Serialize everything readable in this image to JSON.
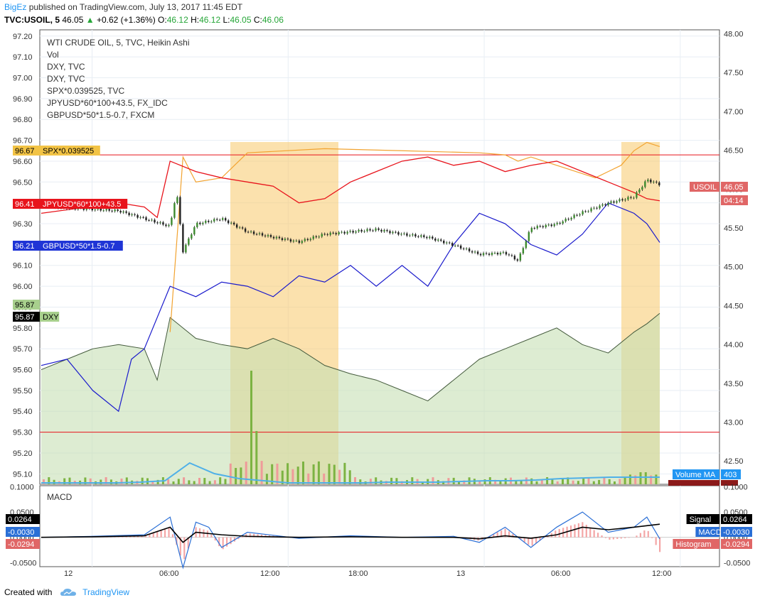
{
  "header": {
    "author": "BigEz",
    "published_text": "published on TradingView.com, July 13, 2017 11:45 EDT",
    "symbol": "TVC:USOIL, 5",
    "last": "46.05",
    "change": "+0.62 (+1.36%)",
    "o_label": "O:",
    "o": "46.12",
    "h_label": "H:",
    "h": "46.12",
    "l_label": "L:",
    "l": "46.05",
    "c_label": "C:",
    "c": "46.06"
  },
  "legend": [
    "WTI CRUDE OIL, 5, TVC, Heikin Ashi",
    "Vol",
    "DXY, TVC",
    "DXY, TVC",
    "SPX*0.039525, TVC",
    "JPYUSD*60*100+43.5, FX_IDC",
    "GBPUSD*50*1.5-0.7, FXCM"
  ],
  "footer": {
    "created_with": "Created with",
    "brand": "TradingView"
  },
  "colors": {
    "oil": "#000000",
    "spx": "#f2a330",
    "jpy": "#e8141c",
    "gbp": "#1a1acc",
    "dxy_fill": "#c6e0b4",
    "dxy_line": "#445a3c",
    "session": "#f7c96a",
    "hline": "#e8141c",
    "vol_up": "#7cb342",
    "vol_down": "#ef9a9a",
    "vol_ma": "#4fb0e8",
    "macd": "#2a6fd6",
    "signal": "#000000",
    "hist": "#f4a6a6"
  },
  "chart_data": [
    {
      "type": "line",
      "title": "WTI CRUDE OIL, 5, TVC, Heikin Ashi",
      "x_ticks": [
        "12",
        "06:00",
        "12:00",
        "18:00",
        "13",
        "06:00",
        "12:00"
      ],
      "left_axis": {
        "ticks": [
          "97.20",
          "97.10",
          "97.00",
          "96.90",
          "96.80",
          "96.70",
          "96.60",
          "96.50",
          "96.40",
          "96.30",
          "96.20",
          "96.10",
          "96.00",
          "95.90",
          "95.80",
          "95.70",
          "95.60",
          "95.50",
          "95.40",
          "95.30",
          "95.20",
          "95.10"
        ],
        "ylim": [
          95.05,
          97.23
        ]
      },
      "right_axis": {
        "ticks": [
          "48.00",
          "47.50",
          "47.00",
          "46.50",
          "46.00",
          "45.50",
          "45.00",
          "44.50",
          "44.00",
          "43.50",
          "43.00",
          "42.50"
        ],
        "ylim": [
          42.2,
          48.05
        ]
      },
      "session_highlights": [
        [
          "10:00",
          "16:00"
        ],
        [
          "10:00",
          "12:00"
        ]
      ],
      "horizontal_lines": [
        96.63,
        95.3
      ],
      "left_tags": [
        {
          "value": "96.67",
          "label": "SPX*0.039525",
          "color": "#f2c345"
        },
        {
          "value": "96.41",
          "label": "JPYUSD*60*100+43.5",
          "color": "#e8141c"
        },
        {
          "value": "96.21",
          "label": "GBPUSD*50*1.5-0.7",
          "color": "#1f35d6"
        },
        {
          "value": "95.87",
          "label": "",
          "color": "#a8d08d"
        },
        {
          "value": "95.87",
          "label": "DXY",
          "color": "#a8d08d"
        }
      ],
      "right_tags": [
        {
          "label": "USOIL",
          "value": "46.05",
          "timer": "04:14",
          "color": "#e06666"
        },
        {
          "label": "Volume MA",
          "value": "403",
          "color": "#2196f3"
        },
        {
          "label": "Volume",
          "value": "",
          "color": "#8b1a1a"
        }
      ],
      "series": [
        {
          "name": "USOIL (Heikin Ashi)",
          "x": [
            0,
            6,
            10,
            10.5,
            11,
            12,
            14,
            16,
            18,
            20,
            22,
            24,
            26,
            28,
            30,
            32,
            34,
            36,
            37,
            38,
            40,
            42,
            44,
            46,
            47,
            48
          ],
          "y": [
            45.78,
            45.72,
            45.52,
            45.98,
            45.2,
            45.55,
            45.62,
            45.45,
            45.38,
            45.32,
            45.42,
            45.45,
            45.48,
            45.42,
            45.38,
            45.28,
            45.16,
            45.18,
            45.08,
            45.5,
            45.55,
            45.7,
            45.82,
            45.9,
            46.12,
            46.06
          ]
        },
        {
          "name": "SPX*0.039525",
          "x": [
            10,
            11,
            12,
            14,
            16,
            22,
            28,
            34,
            36,
            37,
            38,
            40,
            41,
            42,
            43,
            44,
            45,
            46,
            47,
            48
          ],
          "y": [
            95.78,
            96.62,
            96.5,
            96.52,
            96.64,
            96.66,
            96.65,
            96.64,
            96.63,
            96.6,
            96.62,
            96.58,
            96.56,
            96.54,
            96.52,
            96.55,
            96.58,
            96.65,
            96.69,
            96.67
          ]
        },
        {
          "name": "JPYUSD*60*100+43.5",
          "x": [
            0,
            6,
            8,
            9,
            10,
            12,
            14,
            16,
            18,
            20,
            22,
            24,
            26,
            28,
            30,
            32,
            34,
            36,
            38,
            40,
            42,
            44,
            46,
            47,
            48
          ],
          "y": [
            96.35,
            96.4,
            96.38,
            96.33,
            96.6,
            96.55,
            96.52,
            96.5,
            96.48,
            96.4,
            96.42,
            96.5,
            96.55,
            96.6,
            96.62,
            96.58,
            96.6,
            96.55,
            96.58,
            96.6,
            96.55,
            96.5,
            96.45,
            96.42,
            96.41
          ]
        },
        {
          "name": "GBPUSD*50*1.5-0.7",
          "x": [
            0,
            2,
            4,
            6,
            7,
            8,
            10,
            12,
            14,
            16,
            18,
            20,
            22,
            24,
            26,
            28,
            30,
            32,
            34,
            36,
            38,
            40,
            42,
            44,
            46,
            47,
            48
          ],
          "y": [
            95.62,
            95.65,
            95.5,
            95.4,
            95.65,
            95.7,
            96.0,
            95.95,
            96.02,
            96.0,
            95.95,
            96.05,
            96.02,
            96.1,
            96.0,
            96.1,
            96.0,
            96.2,
            96.35,
            96.3,
            96.2,
            96.15,
            96.25,
            96.4,
            96.35,
            96.3,
            96.21
          ]
        },
        {
          "name": "DXY",
          "x": [
            0,
            2,
            4,
            6,
            8,
            9,
            10,
            12,
            14,
            16,
            18,
            20,
            22,
            24,
            26,
            28,
            30,
            32,
            34,
            36,
            38,
            40,
            42,
            44,
            46,
            47,
            48
          ],
          "y": [
            95.6,
            95.65,
            95.7,
            95.72,
            95.7,
            95.55,
            95.85,
            95.75,
            95.72,
            95.7,
            95.75,
            95.7,
            95.62,
            95.58,
            95.55,
            95.5,
            95.45,
            95.55,
            95.65,
            95.7,
            95.75,
            95.8,
            95.72,
            95.68,
            95.78,
            95.82,
            95.87
          ]
        }
      ],
      "volume_ma": [
        0.02,
        0.02,
        0.02,
        0.02,
        0.03,
        0.05,
        0.3,
        0.15,
        0.08,
        0.05,
        0.02,
        0.02,
        0.02,
        0.02,
        0.03,
        0.03,
        0.03,
        0.04,
        0.05,
        0.05,
        0.06,
        0.08,
        0.09,
        0.1,
        0.1,
        0.1
      ]
    },
    {
      "type": "line",
      "title": "MACD",
      "y_ticks": [
        "0.1000",
        "0.0500",
        "0.0000",
        "-0.0500"
      ],
      "ylim": [
        -0.058,
        0.102
      ],
      "left_tags": [
        {
          "value": "0.0264",
          "color": "#000000"
        },
        {
          "value": "-0.0030",
          "color": "#2a6fd6"
        },
        {
          "value": "-0.0294",
          "color": "#e06666"
        }
      ],
      "right_tags": [
        {
          "label": "Signal",
          "value": "0.0264",
          "color": "#000000"
        },
        {
          "label": "MACD",
          "value": "-0.0030",
          "color": "#2a6fd6"
        },
        {
          "label": "Histogram",
          "value": "-0.0294",
          "color": "#e06666"
        }
      ],
      "series": [
        {
          "name": "MACD",
          "x": [
            0,
            4,
            8,
            10,
            11,
            12,
            13,
            14,
            16,
            20,
            24,
            28,
            32,
            34,
            36,
            38,
            40,
            42,
            44,
            46,
            47,
            48
          ],
          "y": [
            0.0,
            0.002,
            0.005,
            0.04,
            -0.06,
            0.03,
            0.02,
            -0.02,
            0.01,
            -0.002,
            0.003,
            0.0,
            0.002,
            -0.01,
            0.02,
            -0.02,
            0.02,
            0.05,
            0.01,
            0.02,
            0.04,
            -0.003
          ]
        },
        {
          "name": "Signal",
          "x": [
            0,
            4,
            8,
            10,
            11,
            12,
            14,
            16,
            20,
            24,
            28,
            32,
            34,
            36,
            38,
            40,
            42,
            44,
            46,
            48
          ],
          "y": [
            0.0,
            0.001,
            0.003,
            0.02,
            -0.01,
            0.01,
            0.005,
            0.002,
            0.0,
            0.001,
            0.0,
            0.0,
            -0.003,
            0.003,
            -0.002,
            0.005,
            0.02,
            0.015,
            0.02,
            0.026
          ]
        }
      ]
    }
  ]
}
